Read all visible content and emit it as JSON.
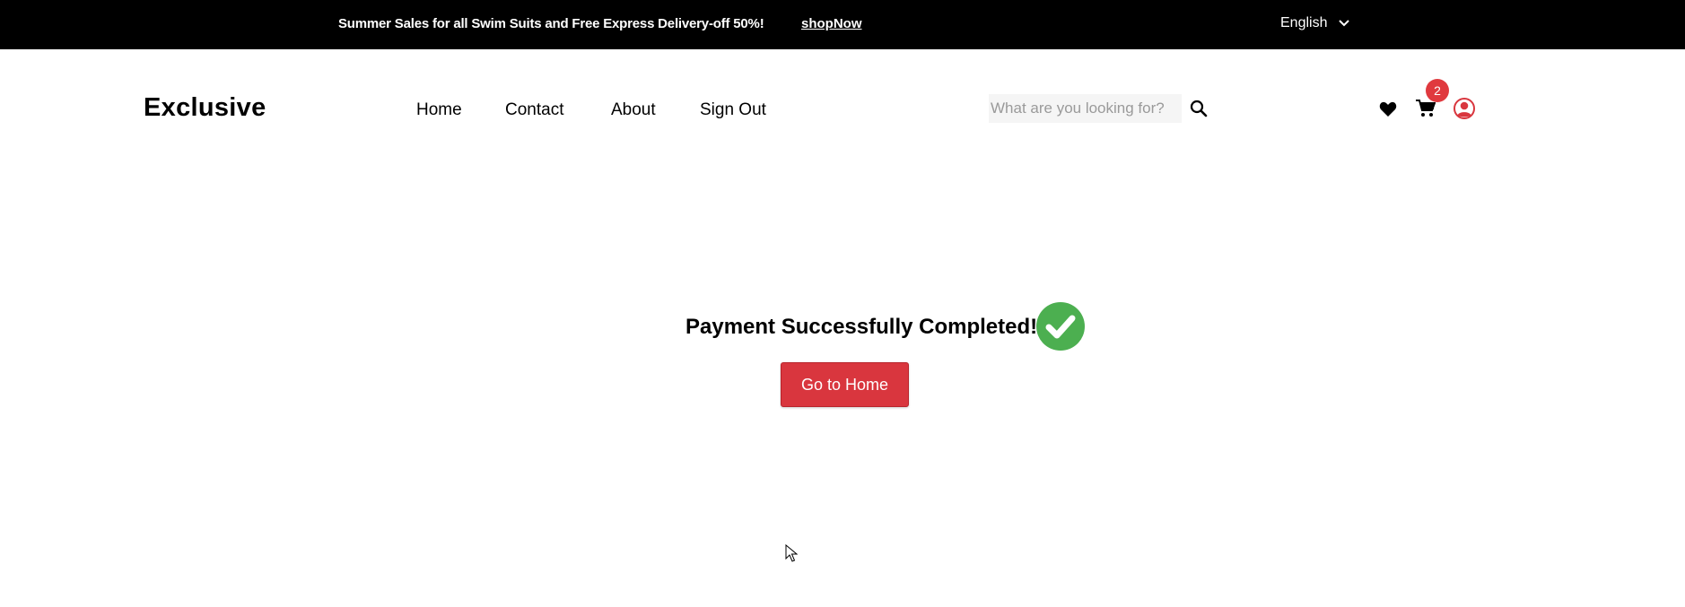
{
  "topbar": {
    "promo": "Summer Sales for all Swim Suits and Free Express Delivery-off 50%!",
    "shop_now": "shopNow",
    "language": "English"
  },
  "header": {
    "brand": "Exclusive",
    "nav": [
      "Home",
      "Contact",
      "About",
      "Sign Out"
    ],
    "search_placeholder": "What are you looking for?",
    "cart_count": "2"
  },
  "main": {
    "message": "Payment Successfully Completed!",
    "button": "Go to Home"
  },
  "colors": {
    "accent": "#d9363e",
    "success": "#4caf50"
  },
  "icons": [
    "chevron-down-icon",
    "search-icon",
    "heart-icon",
    "cart-icon",
    "user-icon",
    "check-circle-icon"
  ]
}
